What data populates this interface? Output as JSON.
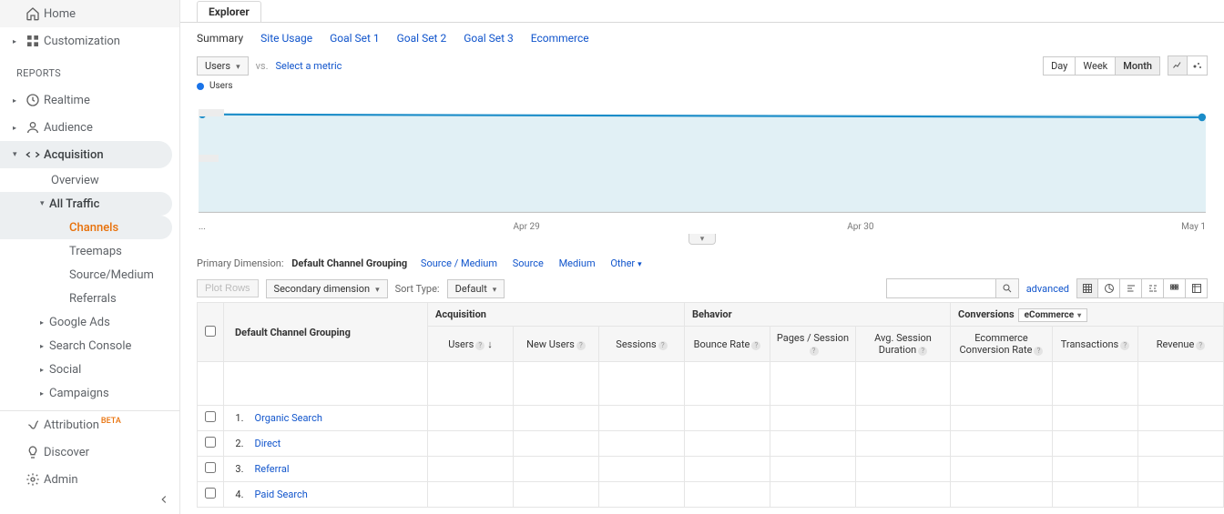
{
  "sidebar": {
    "home": "Home",
    "customization": "Customization",
    "reports_label": "REPORTS",
    "realtime": "Realtime",
    "audience": "Audience",
    "acquisition": "Acquisition",
    "acq": {
      "overview": "Overview",
      "all_traffic": "All Traffic",
      "channels": "Channels",
      "treemaps": "Treemaps",
      "source_medium": "Source/Medium",
      "referrals": "Referrals",
      "google_ads": "Google Ads",
      "search_console": "Search Console",
      "social": "Social",
      "campaigns": "Campaigns"
    },
    "attribution": "Attribution",
    "attribution_badge": "BETA",
    "discover": "Discover",
    "admin": "Admin"
  },
  "explorer": {
    "tab": "Explorer",
    "summary": "Summary",
    "site_usage": "Site Usage",
    "goal1": "Goal Set 1",
    "goal2": "Goal Set 2",
    "goal3": "Goal Set 3",
    "ecommerce": "Ecommerce"
  },
  "metric": {
    "users_btn": "Users",
    "vs": "vs.",
    "select": "Select a metric",
    "day": "Day",
    "week": "Week",
    "month": "Month",
    "legend": "Users"
  },
  "chart_data": {
    "type": "line",
    "title": "",
    "xlabel": "",
    "ylabel": "",
    "ylim": [
      0,
      100
    ],
    "categories": [
      "...",
      "Apr 29",
      "Apr 30",
      "May 1"
    ],
    "series": [
      {
        "name": "Users",
        "values": [
          25,
          25,
          25,
          25
        ]
      }
    ]
  },
  "dim": {
    "primary_label": "Primary Dimension:",
    "default_channel": "Default Channel Grouping",
    "source_medium": "Source / Medium",
    "source": "Source",
    "medium": "Medium",
    "other": "Other"
  },
  "tbl_ctl": {
    "plot_rows": "Plot Rows",
    "secondary_dim": "Secondary dimension",
    "sort_type": "Sort Type:",
    "default": "Default",
    "advanced": "advanced"
  },
  "table": {
    "group_acq": "Acquisition",
    "group_beh": "Behavior",
    "group_conv": "Conversions",
    "conv_select": "eCommerce",
    "col_dim": "Default Channel Grouping",
    "col_users": "Users",
    "col_new_users": "New Users",
    "col_sessions": "Sessions",
    "col_bounce": "Bounce Rate",
    "col_pps": "Pages / Session",
    "col_asd": "Avg. Session Duration",
    "col_ecr": "Ecommerce Conversion Rate",
    "col_trans": "Transactions",
    "col_rev": "Revenue",
    "rows": [
      {
        "idx": "1.",
        "name": "Organic Search"
      },
      {
        "idx": "2.",
        "name": "Direct"
      },
      {
        "idx": "3.",
        "name": "Referral"
      },
      {
        "idx": "4.",
        "name": "Paid Search"
      }
    ]
  }
}
